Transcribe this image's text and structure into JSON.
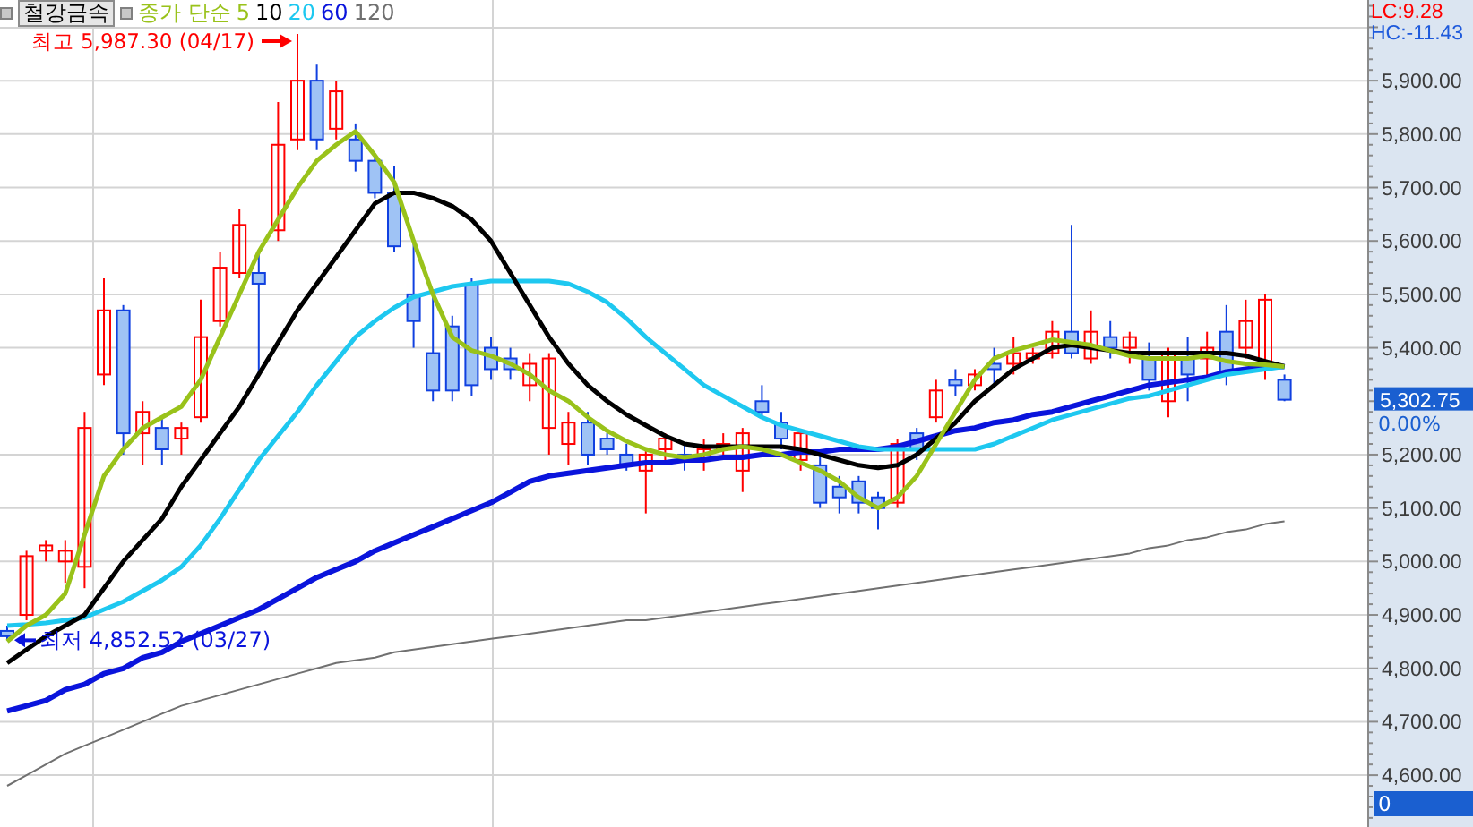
{
  "header": {
    "title": "철강금속",
    "legend_label": "종가 단순"
  },
  "indicators": [
    {
      "text": "LC:9.28",
      "color": "#ff0000"
    },
    {
      "text": "HC:-11.43",
      "color": "#1e5adc"
    }
  ],
  "price_tag": {
    "value": "5,302.75",
    "change": "0.00%"
  },
  "volume_tag": {
    "value": "0"
  },
  "chart": {
    "chart_data": {
      "type": "candlestick",
      "ylim": [
        4503,
        6051
      ],
      "grid": true,
      "categories": [
        null,
        null,
        null,
        null,
        null,
        null,
        null,
        null,
        null,
        null,
        null,
        null,
        null,
        null,
        null,
        null,
        null,
        null,
        null,
        null,
        null,
        null,
        null,
        null,
        null,
        null,
        null,
        null,
        null,
        null,
        null,
        null,
        null,
        null,
        null,
        null,
        null,
        null,
        null,
        null,
        null,
        null,
        null,
        null,
        null,
        null,
        null,
        null,
        null,
        null,
        null,
        null,
        null,
        null,
        null,
        null,
        null,
        null,
        null,
        null,
        null,
        null,
        null,
        null,
        null,
        null,
        null
      ],
      "yticks": [
        {
          "value": 4600,
          "label": "4,600.00"
        },
        {
          "value": 4700,
          "label": "4,700.00"
        },
        {
          "value": 4800,
          "label": "4,800.00"
        },
        {
          "value": 4900,
          "label": "4,900.00"
        },
        {
          "value": 5000,
          "label": "5,000.00"
        },
        {
          "value": 5100,
          "label": "5,100.00"
        },
        {
          "value": 5200,
          "label": "5,200.00"
        },
        {
          "value": 5400,
          "label": "5,400.00"
        },
        {
          "value": 5500,
          "label": "5,500.00"
        },
        {
          "value": 5600,
          "label": "5,600.00"
        },
        {
          "value": 5700,
          "label": "5,700.00"
        },
        {
          "value": 5800,
          "label": "5,800.00"
        },
        {
          "value": 5900,
          "label": "5,900.00"
        }
      ],
      "series": [
        {
          "name": "5",
          "type": "line",
          "color": "#99c21a",
          "values": [
            4850,
            4880,
            4900,
            4940,
            5050,
            5160,
            5210,
            5250,
            5270,
            5290,
            5340,
            5420,
            5500,
            5580,
            5640,
            5700,
            5750,
            5780,
            5805,
            5760,
            5710,
            5600,
            5500,
            5420,
            5395,
            5385,
            5370,
            5350,
            5320,
            5300,
            5270,
            5245,
            5225,
            5210,
            5200,
            5195,
            5200,
            5210,
            5215,
            5210,
            5200,
            5185,
            5170,
            5150,
            5120,
            5100,
            5120,
            5160,
            5220,
            5280,
            5340,
            5380,
            5395,
            5405,
            5415,
            5410,
            5405,
            5395,
            5385,
            5380,
            5380,
            5380,
            5385,
            5375,
            5370,
            5368,
            5365
          ]
        },
        {
          "name": "10",
          "type": "line",
          "color": "#000000",
          "values": [
            4810,
            4835,
            4860,
            4880,
            4900,
            4950,
            5000,
            5040,
            5080,
            5140,
            5190,
            5240,
            5290,
            5350,
            5410,
            5470,
            5520,
            5570,
            5620,
            5670,
            5690,
            5690,
            5680,
            5665,
            5640,
            5600,
            5540,
            5480,
            5420,
            5370,
            5330,
            5300,
            5275,
            5255,
            5235,
            5220,
            5215,
            5215,
            5215,
            5215,
            5215,
            5210,
            5200,
            5190,
            5180,
            5175,
            5180,
            5200,
            5230,
            5260,
            5300,
            5330,
            5360,
            5380,
            5400,
            5405,
            5400,
            5395,
            5390,
            5390,
            5390,
            5390,
            5390,
            5390,
            5385,
            5375,
            5365
          ]
        },
        {
          "name": "20",
          "type": "line",
          "color": "#1ec8f0",
          "values": [
            4880,
            4882,
            4885,
            4890,
            4895,
            4910,
            4925,
            4945,
            4965,
            4990,
            5030,
            5080,
            5135,
            5190,
            5235,
            5280,
            5330,
            5375,
            5420,
            5450,
            5475,
            5495,
            5505,
            5515,
            5520,
            5525,
            5525,
            5525,
            5525,
            5520,
            5505,
            5485,
            5455,
            5420,
            5390,
            5360,
            5330,
            5310,
            5290,
            5270,
            5255,
            5245,
            5235,
            5225,
            5215,
            5210,
            5210,
            5210,
            5210,
            5210,
            5210,
            5220,
            5235,
            5250,
            5265,
            5275,
            5285,
            5295,
            5305,
            5310,
            5320,
            5330,
            5340,
            5350,
            5355,
            5360,
            5365
          ]
        },
        {
          "name": "60",
          "type": "line",
          "color": "#0a14dc",
          "values": [
            4720,
            4730,
            4740,
            4760,
            4770,
            4790,
            4800,
            4820,
            4830,
            4850,
            4865,
            4880,
            4895,
            4910,
            4930,
            4950,
            4970,
            4985,
            5000,
            5020,
            5035,
            5050,
            5065,
            5080,
            5095,
            5110,
            5130,
            5150,
            5160,
            5165,
            5170,
            5175,
            5180,
            5185,
            5185,
            5190,
            5190,
            5195,
            5195,
            5200,
            5200,
            5205,
            5205,
            5210,
            5210,
            5210,
            5215,
            5225,
            5235,
            5245,
            5250,
            5260,
            5265,
            5275,
            5280,
            5290,
            5300,
            5310,
            5320,
            5330,
            5335,
            5340,
            5345,
            5355,
            5360,
            5365,
            5365
          ]
        },
        {
          "name": "120",
          "type": "line",
          "color": "#707070",
          "values": [
            4580,
            4600,
            4620,
            4640,
            4655,
            4670,
            4685,
            4700,
            4715,
            4730,
            4740,
            4750,
            4760,
            4770,
            4780,
            4790,
            4800,
            4810,
            4815,
            4820,
            4830,
            4835,
            4840,
            4845,
            4850,
            4855,
            4860,
            4865,
            4870,
            4875,
            4880,
            4885,
            4890,
            4890,
            4895,
            4900,
            4905,
            4910,
            4915,
            4920,
            4925,
            4930,
            4935,
            4940,
            4945,
            4950,
            4955,
            4960,
            4965,
            4970,
            4975,
            4980,
            4985,
            4990,
            4995,
            5000,
            5005,
            5010,
            5015,
            5025,
            5030,
            5040,
            5045,
            5055,
            5060,
            5070,
            5075
          ]
        }
      ],
      "ohlc": [
        [
          4870,
          4880,
          4852.52,
          4860
        ],
        [
          4900,
          5020,
          4890,
          5010
        ],
        [
          5020,
          5040,
          5000,
          5030
        ],
        [
          5000,
          5040,
          4960,
          5020
        ],
        [
          4990,
          5280,
          4950,
          5250
        ],
        [
          5350,
          5530,
          5330,
          5470
        ],
        [
          5470,
          5480,
          5200,
          5240
        ],
        [
          5240,
          5300,
          5180,
          5280
        ],
        [
          5250,
          5270,
          5180,
          5210
        ],
        [
          5230,
          5260,
          5200,
          5250
        ],
        [
          5270,
          5490,
          5260,
          5420
        ],
        [
          5450,
          5580,
          5440,
          5550
        ],
        [
          5540,
          5660,
          5530,
          5630
        ],
        [
          5540,
          5580,
          5350,
          5520
        ],
        [
          5620,
          5860,
          5600,
          5780
        ],
        [
          5790,
          5987.3,
          5770,
          5900
        ],
        [
          5900,
          5930,
          5770,
          5790
        ],
        [
          5810,
          5900,
          5790,
          5880
        ],
        [
          5790,
          5820,
          5730,
          5750
        ],
        [
          5750,
          5760,
          5680,
          5690
        ],
        [
          5690,
          5740,
          5580,
          5590
        ],
        [
          5500,
          5600,
          5400,
          5450
        ],
        [
          5390,
          5500,
          5300,
          5320
        ],
        [
          5440,
          5460,
          5300,
          5320
        ],
        [
          5520,
          5530,
          5310,
          5330
        ],
        [
          5400,
          5420,
          5340,
          5360
        ],
        [
          5380,
          5400,
          5340,
          5360
        ],
        [
          5330,
          5390,
          5300,
          5370
        ],
        [
          5250,
          5390,
          5200,
          5380
        ],
        [
          5220,
          5280,
          5180,
          5260
        ],
        [
          5260,
          5280,
          5180,
          5200
        ],
        [
          5230,
          5240,
          5200,
          5210
        ],
        [
          5200,
          5220,
          5170,
          5180
        ],
        [
          5170,
          5210,
          5090,
          5200
        ],
        [
          5210,
          5240,
          5180,
          5230
        ],
        [
          5200,
          5220,
          5170,
          5190
        ],
        [
          5200,
          5230,
          5170,
          5210
        ],
        [
          5210,
          5240,
          5190,
          5220
        ],
        [
          5170,
          5250,
          5130,
          5240
        ],
        [
          5300,
          5330,
          5270,
          5280
        ],
        [
          5260,
          5280,
          5210,
          5230
        ],
        [
          5190,
          5240,
          5170,
          5240
        ],
        [
          5180,
          5200,
          5100,
          5110
        ],
        [
          5140,
          5160,
          5090,
          5120
        ],
        [
          5150,
          5160,
          5090,
          5110
        ],
        [
          5120,
          5130,
          5060,
          5100
        ],
        [
          5110,
          5230,
          5100,
          5220
        ],
        [
          5240,
          5250,
          5190,
          5210
        ],
        [
          5270,
          5340,
          5260,
          5320
        ],
        [
          5340,
          5360,
          5310,
          5330
        ],
        [
          5330,
          5360,
          5320,
          5350
        ],
        [
          5370,
          5400,
          5330,
          5360
        ],
        [
          5370,
          5420,
          5350,
          5390
        ],
        [
          5380,
          5400,
          5370,
          5390
        ],
        [
          5390,
          5450,
          5380,
          5430
        ],
        [
          5430,
          5630,
          5380,
          5390
        ],
        [
          5380,
          5470,
          5370,
          5430
        ],
        [
          5420,
          5450,
          5380,
          5400
        ],
        [
          5400,
          5430,
          5370,
          5420
        ],
        [
          5380,
          5410,
          5320,
          5340
        ],
        [
          5300,
          5400,
          5270,
          5390
        ],
        [
          5380,
          5420,
          5300,
          5350
        ],
        [
          5380,
          5430,
          5340,
          5400
        ],
        [
          5430,
          5480,
          5330,
          5350
        ],
        [
          5400,
          5490,
          5380,
          5450
        ],
        [
          5370,
          5500,
          5340,
          5490
        ],
        [
          5340,
          5350,
          5300,
          5302.75
        ]
      ],
      "annotations": [
        "최고 5,987.30 (04/17)",
        "최저 4,852.52 (03/27)"
      ]
    }
  }
}
